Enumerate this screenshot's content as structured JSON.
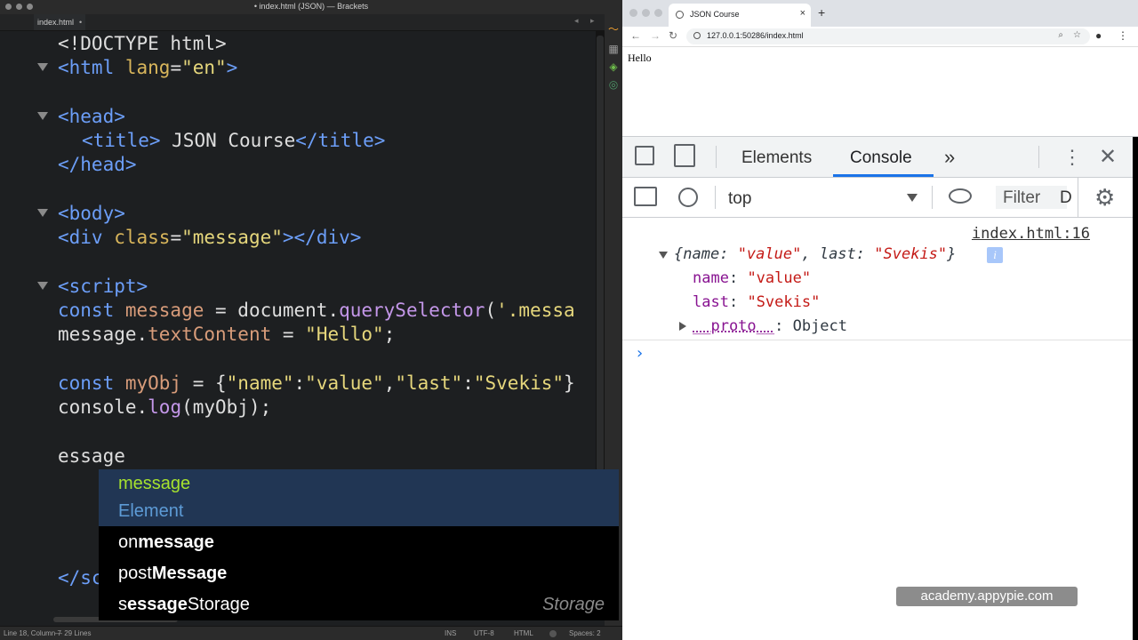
{
  "editor": {
    "window_title": "• index.html (JSON) — Brackets",
    "tab": "index.html",
    "tab_close": "•",
    "tab_nav_prev": "◂",
    "tab_nav_next": "▸",
    "code": {
      "l1": "<!DOCTYPE html>",
      "l2_open": "<html ",
      "l2_attr": "lang",
      "l2_eq": "=",
      "l2_val": "\"en\"",
      "l2_close": ">",
      "l4": "<head>",
      "l5_open": "<title>",
      "l5_text": " JSON Course",
      "l5_close": "</title>",
      "l6": "</head>",
      "l8": "<body>",
      "l9_open": "<div ",
      "l9_attr": "class",
      "l9_eq": "=",
      "l9_val": "\"message\"",
      "l9_close": "></div>",
      "l11": "<script>",
      "l12_kw": "const ",
      "l12_var": "message",
      "l12_eq": " = document.",
      "l12_fn": "querySelector",
      "l12_paren": "(",
      "l12_str": "'.messa",
      "l13_obj": "message.",
      "l13_prop": "textContent",
      "l13_eq": " = ",
      "l13_str": "\"Hello\"",
      "l13_end": ";",
      "l15_kw": "const ",
      "l15_var": "myObj",
      "l15_eq": " = {",
      "l15_k1": "\"name\"",
      "l15_c1": ":",
      "l15_v1": "\"value\"",
      "l15_comma": ",",
      "l15_k2": "\"last\"",
      "l15_c2": ":",
      "l15_v2": "\"Svekis\"",
      "l15_end": "}",
      "l16_obj": "console.",
      "l16_fn": "log",
      "l16_rest": "(myObj);",
      "l18": "essage",
      "l_close": "</sc"
    },
    "hints": [
      {
        "label": "message",
        "type": "Element"
      },
      {
        "label": "onmessage",
        "pre": "on",
        "match": "message"
      },
      {
        "label": "postMessage",
        "pre": "post",
        "match": "Message"
      },
      {
        "label": "sessionStorage",
        "pre": "s",
        "match": "essage",
        "type": "Storage"
      }
    ],
    "status": {
      "position": "Line 18, Column 7",
      "lines": "— 29 Lines",
      "mode": "INS",
      "encoding": "UTF-8",
      "language": "HTML",
      "spaces": "Spaces: 2"
    }
  },
  "browser": {
    "tab_title": "JSON Course",
    "tab_close": "×",
    "new_tab": "+",
    "url": "127.0.0.1:50286/index.html",
    "page_text": "Hello",
    "devtools": {
      "tabs": [
        "Elements",
        "Console"
      ],
      "more_tabs": "»",
      "context": "top",
      "filter_placeholder": "Filter",
      "filter_cut": "D",
      "source_link": "index.html:16",
      "object_preview": {
        "open": "{",
        "k1": "name",
        "v1": "\"value\"",
        "k2": "last",
        "v2": "\"Svekis\"",
        "close": "}"
      },
      "props": [
        {
          "key": "name",
          "value": "\"value\""
        },
        {
          "key": "last",
          "value": "\"Svekis\""
        }
      ],
      "proto_key": "__proto__",
      "proto_value": ": Object",
      "info_badge": "i",
      "prompt": "›"
    }
  },
  "watermark": "academy.appypie.com"
}
